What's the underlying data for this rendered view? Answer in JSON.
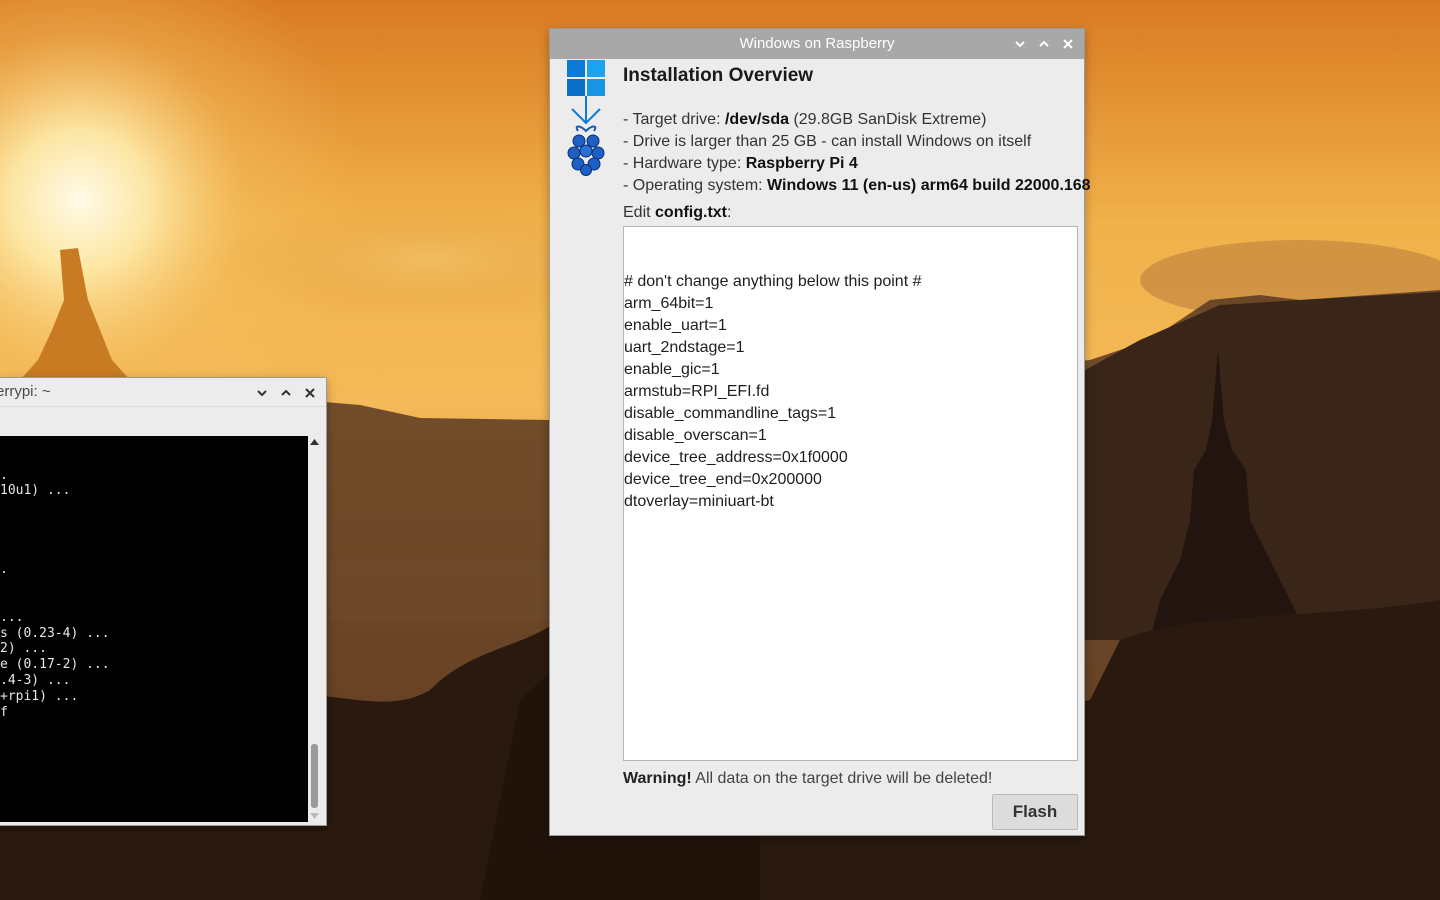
{
  "desktop": {
    "colors": {
      "sky_top": "#e38a28",
      "sky_glow": "#fff3c6",
      "hills": "#2b1a10"
    }
  },
  "terminal": {
    "title": "errypi: ~",
    "lines": [
      "",
      "",
      ".",
      "10u1) ...",
      "",
      "",
      "",
      "",
      ".",
      "",
      "",
      "...",
      "s (0.23-4) ...",
      "2) ...",
      "e (0.17-2) ...",
      ".4-3) ...",
      "+rpi1) ...",
      "f"
    ]
  },
  "installer": {
    "window_title": "Windows on Raspberry",
    "heading": "Installation Overview",
    "target": {
      "prefix": "- Target drive: ",
      "device": "/dev/sda",
      "suffix": " (29.8GB SanDisk Extreme)"
    },
    "drive_note": "- Drive is larger than 25 GB - can install Windows on itself",
    "hardware": {
      "prefix": "- Hardware type: ",
      "value": "Raspberry Pi 4"
    },
    "os": {
      "prefix": "- Operating system: ",
      "value": "Windows 11 (en-us) arm64 build 22000.168"
    },
    "edit": {
      "prefix": "Edit ",
      "file": "config.txt",
      "suffix": ":"
    },
    "config_text": "\n\n# don't change anything below this point #\narm_64bit=1\nenable_uart=1\nuart_2ndstage=1\nenable_gic=1\narmstub=RPI_EFI.fd\ndisable_commandline_tags=1\ndisable_overscan=1\ndevice_tree_address=0x1f0000\ndevice_tree_end=0x200000\ndtoverlay=miniuart-bt",
    "warning": {
      "strong": "Warning!",
      "text": " All data on the target drive will be deleted!"
    },
    "flash_label": "Flash",
    "colors": {
      "windows_blue": "#0a7bd8",
      "raspberry_blue": "#1e5fc4"
    }
  }
}
